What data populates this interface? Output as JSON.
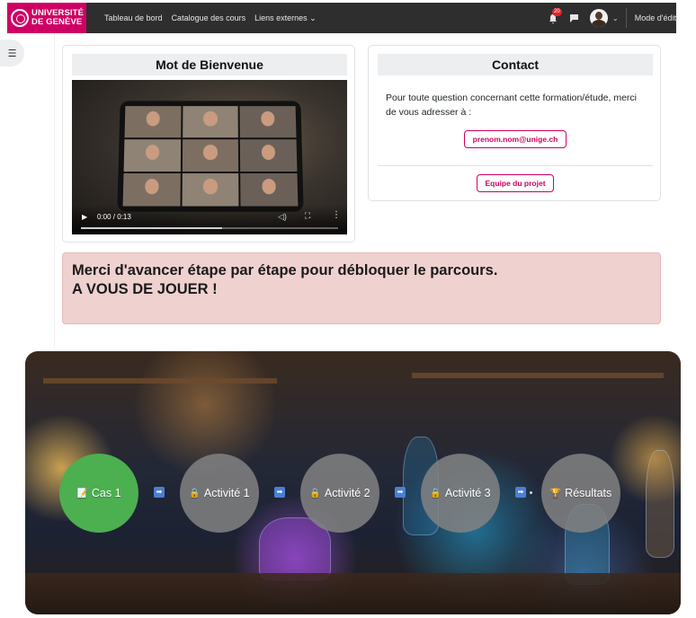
{
  "navbar": {
    "brand_line1": "UNIVERSITÉ",
    "brand_line2": "DE GENÈVE",
    "links": [
      "Tableau de bord",
      "Catalogue des cours",
      "Liens externes ⌄"
    ],
    "notification_count": "20",
    "edit_mode_label": "Mode d'édit",
    "icons": [
      "bell-icon",
      "chat-icon",
      "chevron-down-icon"
    ]
  },
  "drawer": {
    "icon": "list-icon",
    "glyph": "☰"
  },
  "welcome_card": {
    "title": "Mot de Bienvenue",
    "video": {
      "time": "0:00 / 0:13",
      "progress_buffered": 0.55,
      "play_glyph": "▶",
      "volume_glyph": "◁)",
      "fullscreen_glyph": "⛶",
      "more_glyph": "⋮"
    }
  },
  "contact_card": {
    "title": "Contact",
    "text": "Pour toute question concernant cette formation/étude, merci de vous adresser à :",
    "email": "prenom.nom@unige.ch",
    "team_button": "Equipe du projet"
  },
  "alert": {
    "line1": "Merci d'avancer étape par étape pour débloquer le parcours.",
    "line2": "A VOUS DE JOUER !"
  },
  "game_path": {
    "steps": [
      {
        "label": "Cas 1",
        "icon": "document-icon",
        "glyph": "📝",
        "state": "done",
        "color": "#4caf50"
      },
      {
        "label": "Activité 1",
        "icon": "lock-icon",
        "glyph": "🔒",
        "state": "locked"
      },
      {
        "label": "Activité 2",
        "icon": "lock-icon",
        "glyph": "🔒",
        "state": "locked"
      },
      {
        "label": "Activité 3",
        "icon": "lock-icon",
        "glyph": "🔒",
        "state": "locked"
      },
      {
        "label": "Résultats",
        "icon": "trophy-icon",
        "glyph": "🏆",
        "state": "locked"
      }
    ],
    "connector_glyph": "➡",
    "connector_color": "#4a7fd6"
  },
  "colors": {
    "brand": "#cf0063",
    "navbar": "#2e2e2e",
    "alert_bg": "#efd1cf",
    "step_done": "#4caf50"
  }
}
